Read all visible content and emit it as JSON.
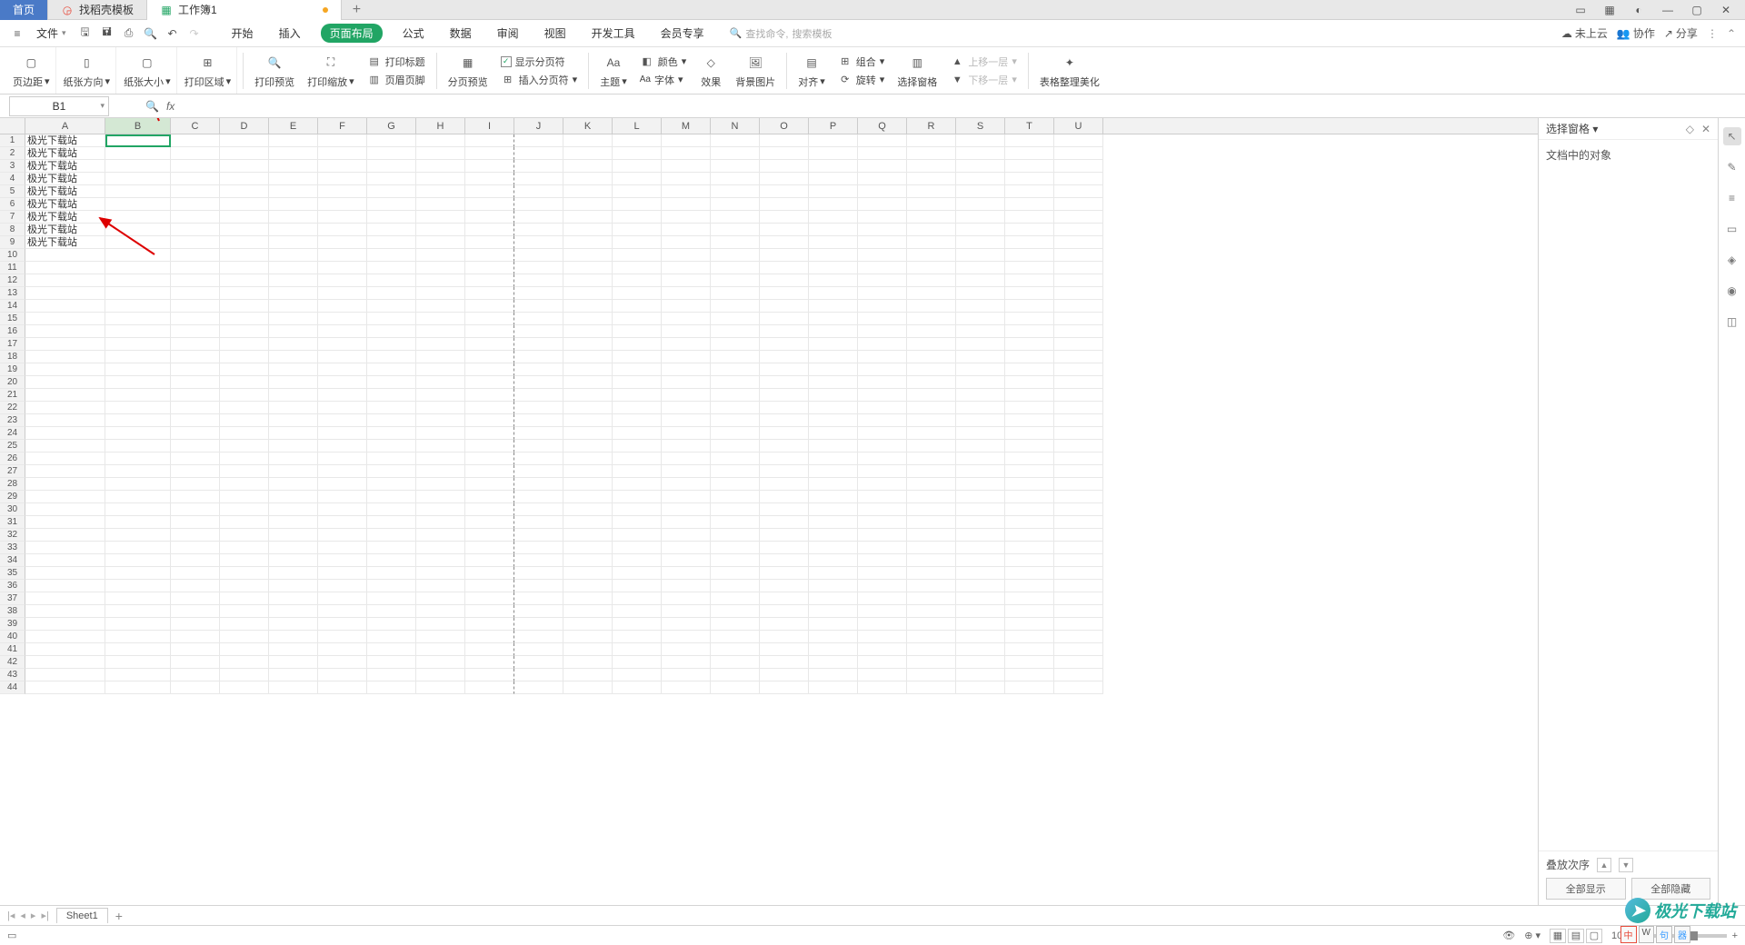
{
  "tabs": {
    "home": "首页",
    "template": "找稻壳模板",
    "workbook": "工作簿1"
  },
  "quick": {
    "file": "文件"
  },
  "ribbon_tabs": [
    "开始",
    "插入",
    "页面布局",
    "公式",
    "数据",
    "审阅",
    "视图",
    "开发工具",
    "会员专享"
  ],
  "ribbon_tabs_active_index": 2,
  "search": {
    "placeholder1": "查找命令,",
    "placeholder2": "搜索模板"
  },
  "right_menu": {
    "cloud": "未上云",
    "collab": "协作",
    "share": "分享"
  },
  "ribbon": {
    "margin": "页边距",
    "orient": "纸张方向",
    "size": "纸张大小",
    "area": "打印区域",
    "preview": "打印预览",
    "scale": "打印缩放",
    "titles": "打印标题",
    "hf": "页眉页脚",
    "pagebreak_preview": "分页预览",
    "show_breaks": "显示分页符",
    "insert_break": "插入分页符",
    "theme": "主题",
    "font": "字体",
    "color": "颜色",
    "effect": "效果",
    "bgimg": "背景图片",
    "align": "对齐",
    "group": "组合",
    "rotate": "旋转",
    "selpane": "选择窗格",
    "up": "上移一层",
    "down": "下移一层",
    "beautify": "表格整理美化"
  },
  "cellref": "B1",
  "columns": [
    "A",
    "B",
    "C",
    "D",
    "E",
    "F",
    "G",
    "H",
    "I",
    "J",
    "K",
    "L",
    "M",
    "N",
    "O",
    "P",
    "Q",
    "R",
    "S",
    "T",
    "U"
  ],
  "row_count": 44,
  "data_rows": 9,
  "cell_text": "极光下载站",
  "right_panel": {
    "title": "选择窗格",
    "subtitle": "文档中的对象",
    "stack": "叠放次序",
    "show_all": "全部显示",
    "hide_all": "全部隐藏"
  },
  "sheet": {
    "name": "Sheet1"
  },
  "status": {
    "zoom": "100%"
  },
  "watermark": "极光下载站",
  "ime": [
    "中",
    "W",
    "句",
    "器"
  ]
}
